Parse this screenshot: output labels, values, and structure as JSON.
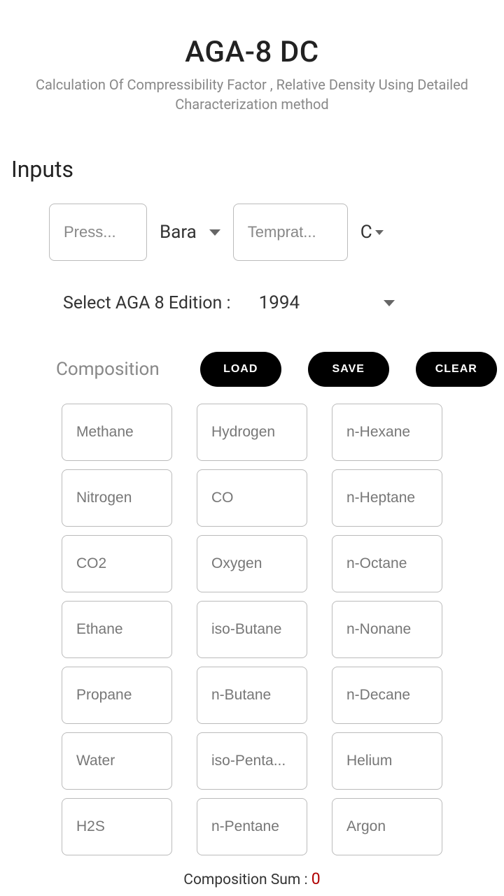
{
  "header": {
    "title": "AGA-8 DC",
    "subtitle": "Calculation Of Compressibility Factor , Relative Density Using Detailed Characterization method"
  },
  "inputs": {
    "section_label": "Inputs",
    "pressure_placeholder": "Press...",
    "pressure_unit": "Bara",
    "temperature_placeholder": "Temprat...",
    "temperature_unit": "C"
  },
  "edition": {
    "label": "Select AGA 8 Edition :",
    "value": "1994"
  },
  "composition": {
    "label": "Composition",
    "buttons": {
      "load": "LOAD",
      "save": "SAVE",
      "clear": "CLEAR"
    },
    "fields": [
      "Methane",
      "Hydrogen",
      "n-Hexane",
      "Nitrogen",
      "CO",
      "n-Heptane",
      "CO2",
      "Oxygen",
      "n-Octane",
      "Ethane",
      "iso-Butane",
      "n-Nonane",
      "Propane",
      "n-Butane",
      "n-Decane",
      "Water",
      "iso-Penta...",
      "Helium",
      "H2S",
      "n-Pentane",
      "Argon"
    ],
    "sum_label": "Composition Sum : ",
    "sum_value": "0"
  }
}
